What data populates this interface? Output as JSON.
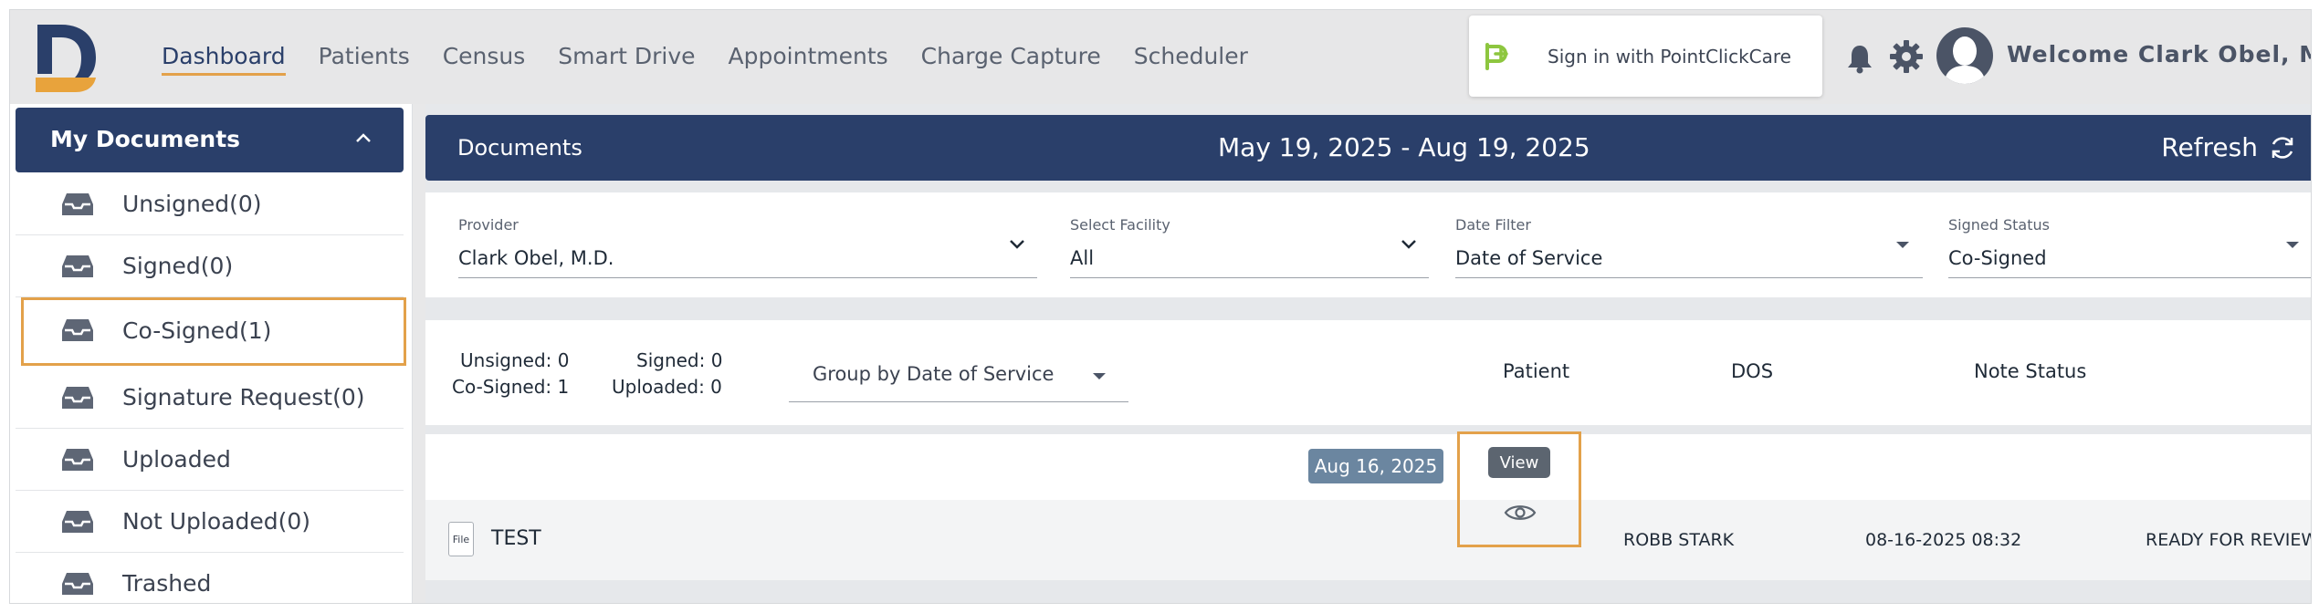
{
  "header": {
    "nav": [
      "Dashboard",
      "Patients",
      "Census",
      "Smart Drive",
      "Appointments",
      "Charge Capture",
      "Scheduler"
    ],
    "active_nav": "Dashboard",
    "pcc_button": "Sign in with PointClickCare",
    "welcome": "Welcome Clark Obel, M.D."
  },
  "sidebar": {
    "title": "My Documents",
    "items": [
      {
        "label": "Unsigned(0)"
      },
      {
        "label": "Signed(0)"
      },
      {
        "label": "Co-Signed(1)"
      },
      {
        "label": "Signature Request(0)"
      },
      {
        "label": "Uploaded"
      },
      {
        "label": "Not Uploaded(0)"
      },
      {
        "label": "Trashed"
      }
    ],
    "selected_index": 2
  },
  "documents": {
    "title": "Documents",
    "date_range": "May 19, 2025 - Aug 19, 2025",
    "refresh_label": "Refresh"
  },
  "filters": {
    "provider": {
      "caption": "Provider",
      "value": "Clark Obel, M.D."
    },
    "facility": {
      "caption": "Select Facility",
      "value": "All"
    },
    "date_filter": {
      "caption": "Date Filter",
      "value": "Date of Service"
    },
    "signed_status": {
      "caption": "Signed Status",
      "value": "Co-Signed"
    }
  },
  "summary": {
    "unsigned": "Unsigned: 0",
    "signed": "Signed: 0",
    "cosigned": "Co-Signed: 1",
    "uploaded": "Uploaded: 0",
    "group_by": "Group by Date of Service",
    "columns": {
      "patient": "Patient",
      "dos": "DOS",
      "note_status": "Note Status"
    }
  },
  "rows": {
    "group_date": "Aug 16, 2025",
    "items": [
      {
        "file_icon_label": "File",
        "name": "TEST",
        "view_tooltip": "View",
        "patient": "ROBB STARK",
        "dos": "08-16-2025 08:32",
        "status": "READY FOR REVIEW"
      }
    ]
  },
  "colors": {
    "navy": "#2a3f6a",
    "accent_orange": "#e3a14a",
    "pcc_green": "#8dc63f",
    "badge": "#6b86a0"
  },
  "icons": {
    "logo": "d-logo-icon",
    "pcc": "pointclickcare-icon",
    "bell": "bell-icon",
    "gear": "gear-icon",
    "avatar": "user-avatar-icon",
    "inbox": "inbox-tray-icon",
    "refresh": "refresh-icon",
    "eye": "eye-icon",
    "file": "file-icon"
  }
}
